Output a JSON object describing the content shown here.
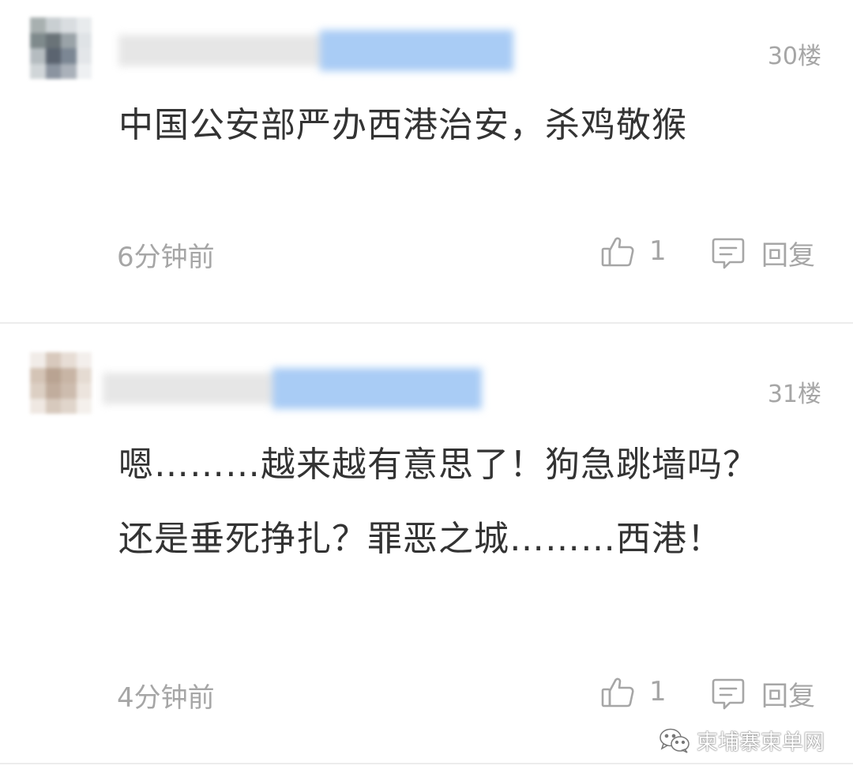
{
  "comments": [
    {
      "floor": "30楼",
      "text": "中国公安部严办西港治安，杀鸡敬猴",
      "time": "6分钟前",
      "likes": "1",
      "reply_label": "回复"
    },
    {
      "floor": "31楼",
      "text": "嗯………越来越有意思了！狗急跳墙吗？还是垂死挣扎？罪恶之城………西港！",
      "time": "4分钟前",
      "likes": "1",
      "reply_label": "回复"
    }
  ],
  "icons": {
    "like": "thumbs-up-icon",
    "reply": "comment-bubble-icon",
    "watermark": "wechat-icon"
  },
  "watermark": {
    "text": "柬埔寨柬单网"
  },
  "colors": {
    "text": "#333333",
    "meta": "#a6a6a6",
    "divider": "#ececec"
  }
}
